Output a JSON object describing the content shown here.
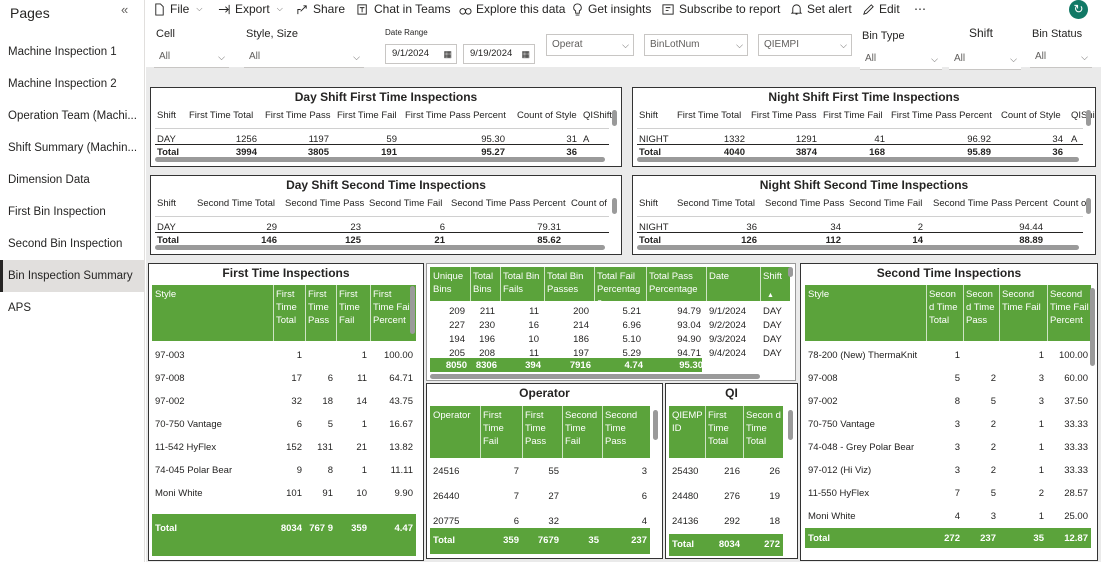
{
  "sidebar": {
    "title": "Pages",
    "pages": [
      "Machine Inspection 1",
      "Machine Inspection 2",
      "Operation Team (Machi...",
      "Shift Summary (Machin...",
      "Dimension Data",
      "First Bin Inspection",
      "Second Bin Inspection",
      "Bin Inspection Summary",
      "APS"
    ],
    "active": 7
  },
  "toolbar": {
    "file": "File",
    "export": "Export",
    "share": "Share",
    "chat": "Chat in Teams",
    "explore": "Explore this data",
    "insights": "Get insights",
    "subscribe": "Subscribe to report",
    "alert": "Set alert",
    "edit": "Edit",
    "more": "⋯"
  },
  "filters": {
    "cell_label": "Cell",
    "cell_value": "All",
    "style_label": "Style, Size",
    "style_value": "All",
    "date_label": "Date Range",
    "date_from": "9/1/2024",
    "date_to": "9/19/2024",
    "operat_ph": "Operat",
    "binlot_ph": "BinLotNum",
    "qiempi_ph": "QIEMPI",
    "bintype_label": "Bin Type",
    "bintype_value": "All",
    "shift_label": "Shift",
    "shift_value": "All",
    "binstatus_label": "Bin Status",
    "binstatus_value": "All"
  },
  "day_first": {
    "title": "Day Shift First Time Inspections",
    "headers": [
      "Shift",
      "First Time Total",
      "First Time Pass",
      "First Time Fail",
      "First Time Pass Percent",
      "Count of Style",
      "QIShift"
    ],
    "row": [
      "DAY",
      "1256",
      "1197",
      "59",
      "95.30",
      "31",
      "A"
    ],
    "total": [
      "Total",
      "3994",
      "3805",
      "191",
      "95.27",
      "36"
    ]
  },
  "night_first": {
    "title": "Night Shift First Time Inspections",
    "headers": [
      "Shift",
      "First Time Total",
      "First Time Pass",
      "First Time Fail",
      "First Time Pass Percent",
      "Count of Style",
      "QIShi"
    ],
    "row": [
      "NIGHT",
      "1332",
      "1291",
      "41",
      "96.92",
      "34",
      "A"
    ],
    "total": [
      "Total",
      "4040",
      "3874",
      "168",
      "95.89",
      "36"
    ]
  },
  "day_second": {
    "title": "Day Shift Second Time Inspections",
    "headers": [
      "Shift",
      "Second Time Total",
      "Second Time Pass",
      "Second Time Fail",
      "Second Time Pass Percent",
      "Count of"
    ],
    "row": [
      "DAY",
      "29",
      "23",
      "6",
      "79.31"
    ],
    "total": [
      "Total",
      "146",
      "125",
      "21",
      "85.62"
    ]
  },
  "night_second": {
    "title": "Night Shift Second Time Inspections",
    "headers": [
      "Shift",
      "Second Time Total",
      "Second Time Pass",
      "Second Time Fail",
      "Second Time Pass Percent",
      "Count o"
    ],
    "row": [
      "NIGHT",
      "36",
      "34",
      "2",
      "94.44"
    ],
    "total": [
      "Total",
      "126",
      "112",
      "14",
      "88.89"
    ]
  },
  "first_time": {
    "title": "First Time Inspections",
    "headers": [
      "Style",
      "First Time Total",
      "First Time Pass",
      "First Time Fail",
      "First Time Fail Percent"
    ],
    "rows": [
      [
        "97-003",
        "1",
        "",
        "1",
        "100.00"
      ],
      [
        "97-008",
        "17",
        "6",
        "11",
        "64.71"
      ],
      [
        "97-002",
        "32",
        "18",
        "14",
        "43.75"
      ],
      [
        "70-750 Vantage",
        "6",
        "5",
        "1",
        "16.67"
      ],
      [
        "11-542 HyFlex",
        "152",
        "131",
        "21",
        "13.82"
      ],
      [
        "74-045 Polar Bear",
        "9",
        "8",
        "1",
        "11.11"
      ],
      [
        "Moni White",
        "101",
        "91",
        "10",
        "9.90"
      ]
    ],
    "total": [
      "Total",
      "8034",
      "767 9",
      "359",
      "4.47"
    ]
  },
  "bins": {
    "headers": [
      "Unique Bins",
      "Total Bins",
      "Total Bin Fails",
      "Total Bin Passes",
      "Total Fail Percentage",
      "Total Pass Percentage",
      "Date",
      "Shift"
    ],
    "rows": [
      [
        "209",
        "211",
        "11",
        "200",
        "5.21",
        "94.79",
        "9/1/2024",
        "DAY"
      ],
      [
        "227",
        "230",
        "16",
        "214",
        "6.96",
        "93.04",
        "9/2/2024",
        "DAY"
      ],
      [
        "194",
        "196",
        "10",
        "186",
        "5.10",
        "94.90",
        "9/3/2024",
        "DAY"
      ],
      [
        "205",
        "208",
        "11",
        "197",
        "5.29",
        "94.71",
        "9/4/2024",
        "DAY"
      ]
    ],
    "total": [
      "8050",
      "8306",
      "394",
      "7916",
      "4.74",
      "95.30"
    ]
  },
  "operator": {
    "title": "Operator",
    "headers": [
      "Operator",
      "First Time Fail",
      "First Time Pass",
      "Second Time Fail",
      "Second Time Pass"
    ],
    "rows": [
      [
        "24516",
        "7",
        "55",
        "",
        "3"
      ],
      [
        "26440",
        "7",
        "27",
        "",
        "6"
      ],
      [
        "20775",
        "6",
        "32",
        "",
        "4"
      ]
    ],
    "total": [
      "Total",
      "359",
      "7679",
      "35",
      "237"
    ]
  },
  "qi": {
    "title": "QI",
    "headers": [
      "QIEMP ID",
      "First Time Total",
      "Secon d Time Total"
    ],
    "rows": [
      [
        "25430",
        "216",
        "26"
      ],
      [
        "24480",
        "276",
        "19"
      ],
      [
        "24136",
        "292",
        "18"
      ]
    ],
    "total": [
      "Total",
      "8034",
      "272"
    ]
  },
  "second_time": {
    "title": "Second Time Inspections",
    "headers": [
      "Style",
      "Second Time Total",
      "Second Time Pass",
      "Second Time Fail",
      "Second Time Fail Percent"
    ],
    "rows": [
      [
        "78-200 (New) ThermaKnit",
        "1",
        "",
        "1",
        "100.00"
      ],
      [
        "97-008",
        "5",
        "2",
        "3",
        "60.00"
      ],
      [
        "97-002",
        "8",
        "5",
        "3",
        "37.50"
      ],
      [
        "70-750 Vantage",
        "3",
        "2",
        "1",
        "33.33"
      ],
      [
        "74-048 - Grey Polar Bear",
        "3",
        "2",
        "1",
        "33.33"
      ],
      [
        "97-012 (Hi Viz)",
        "3",
        "2",
        "1",
        "33.33"
      ],
      [
        "11-550 HyFlex",
        "7",
        "5",
        "2",
        "28.57"
      ],
      [
        "Moni White",
        "4",
        "3",
        "1",
        "25.00"
      ]
    ],
    "total": [
      "Total",
      "272",
      "237",
      "35",
      "12.87"
    ]
  },
  "colors": {
    "green": "#5ba33b",
    "teal": "#117865"
  }
}
